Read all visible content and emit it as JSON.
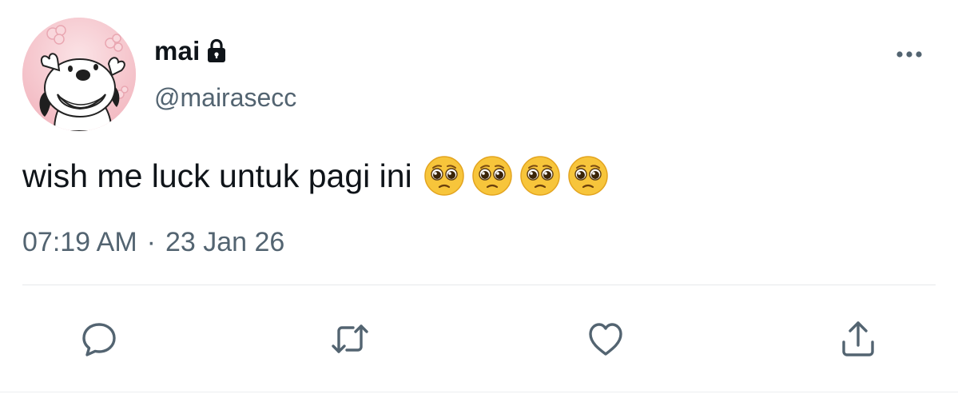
{
  "user": {
    "display_name": "mai",
    "handle": "@mairasecc",
    "avatar_icon": "cartoon-dog-avatar",
    "protected_icon": "lock-icon"
  },
  "tweet": {
    "text": "wish me luck untuk pagi ini",
    "emojis": [
      "pleading-face",
      "pleading-face",
      "pleading-face",
      "pleading-face"
    ],
    "time": "07:19 AM",
    "separator": "·",
    "date": "23 Jan 26"
  },
  "actions": {
    "reply_icon": "reply-icon",
    "retweet_icon": "retweet-icon",
    "like_icon": "heart-icon",
    "share_icon": "share-icon",
    "more_icon": "more-icon"
  },
  "colors": {
    "text_primary": "#0f1419",
    "text_secondary": "#536471",
    "icon": "#536471",
    "divider": "#e6e9eb",
    "avatar_bg": "#f6c9cf"
  }
}
